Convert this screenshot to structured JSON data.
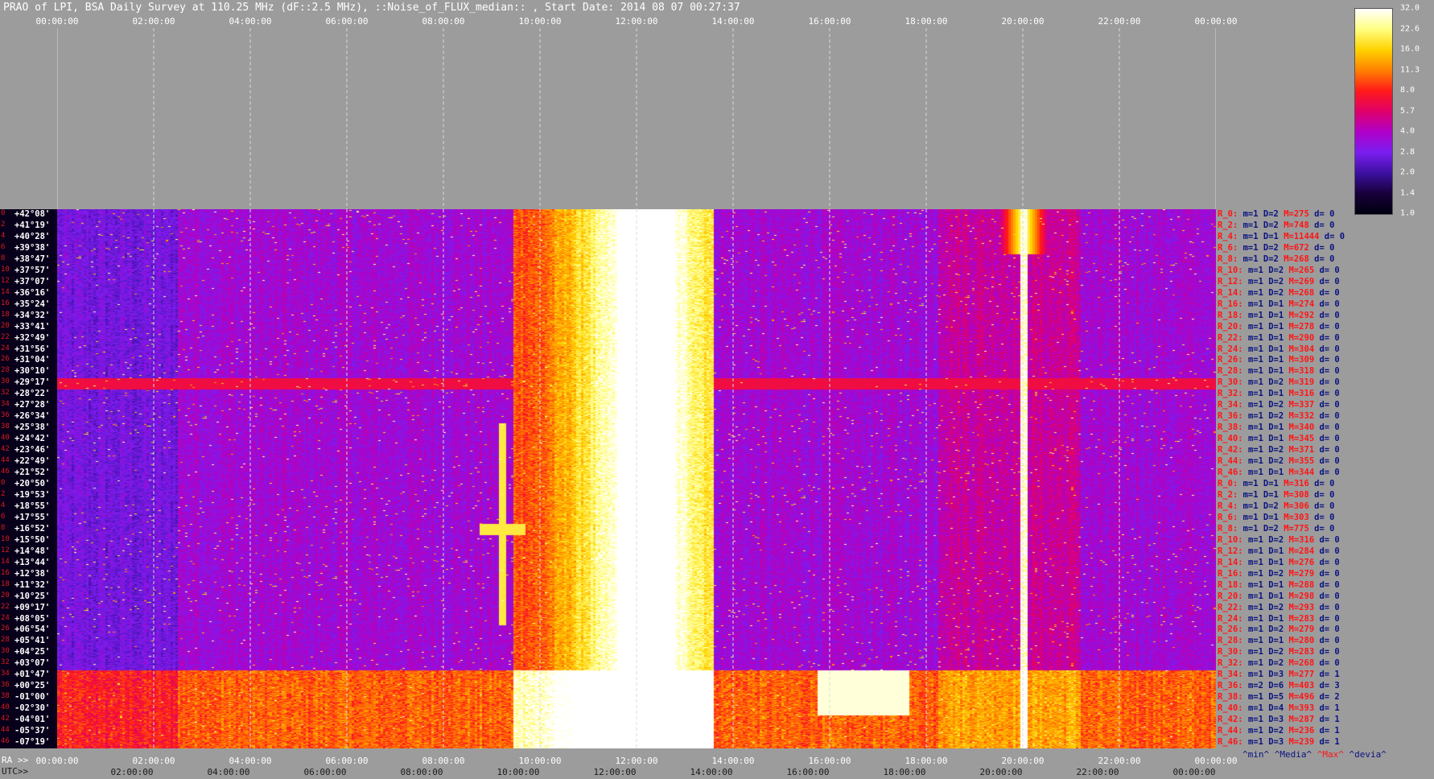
{
  "title": "PRAO of LPI, BSA Daily Survey at 110.25 MHz (dF::2.5 MHz), ::Noise_of_FLUX_median:: , Start Date: 2014 08 07 00:27:37",
  "top_axis": [
    "00:00:00",
    "02:00:00",
    "04:00:00",
    "06:00:00",
    "08:00:00",
    "10:00:00",
    "12:00:00",
    "14:00:00",
    "16:00:00",
    "18:00:00",
    "20:00:00",
    "22:00:00",
    "00:00:00"
  ],
  "bottom_axis": {
    "ra_label": "RA >>",
    "ra_ticks": [
      "00:00:00",
      "02:00:00",
      "04:00:00",
      "06:00:00",
      "08:00:00",
      "10:00:00",
      "12:00:00",
      "14:00:00",
      "16:00:00",
      "18:00:00",
      "20:00:00",
      "22:00:00",
      "00:00:00"
    ],
    "utc_label": "UTC>>",
    "utc_ticks": [
      "02:00:00",
      "04:00:00",
      "06:00:00",
      "08:00:00",
      "10:00:00",
      "12:00:00",
      "14:00:00",
      "16:00:00",
      "18:00:00",
      "20:00:00",
      "22:00:00",
      "00:00:00"
    ]
  },
  "declinations": [
    "+42°08'",
    "+41°19'",
    "+40°28'",
    "+39°38'",
    "+38°47'",
    "+37°57'",
    "+37°07'",
    "+36°16'",
    "+35°24'",
    "+34°32'",
    "+33°41'",
    "+32°49'",
    "+31°56'",
    "+31°04'",
    "+30°10'",
    "+29°17'",
    "+28°22'",
    "+27°28'",
    "+26°34'",
    "+25°38'",
    "+24°42'",
    "+23°46'",
    "+22°49'",
    "+21°52'",
    "+20°50'",
    "+19°53'",
    "+18°55'",
    "+17°55'",
    "+16°52'",
    "+15°50'",
    "+14°48'",
    "+13°44'",
    "+12°38'",
    "+11°32'",
    "+10°25'",
    "+09°17'",
    "+08°05'",
    "+06°54'",
    "+05°41'",
    "+04°25'",
    "+03°07'",
    "+01°47'",
    "+00°25'",
    "-01°00'",
    "-02°30'",
    "-04°01'",
    "-05°37'",
    "-07°19'"
  ],
  "row_indices": [
    "0",
    "2",
    "4",
    "6",
    "8",
    "10",
    "12",
    "14",
    "16",
    "18",
    "20",
    "22",
    "24",
    "26",
    "28",
    "30",
    "32",
    "34",
    "36",
    "38",
    "40",
    "42",
    "44",
    "46",
    "0",
    "2",
    "4",
    "6",
    "8",
    "10",
    "12",
    "14",
    "16",
    "18",
    "20",
    "22",
    "24",
    "26",
    "28",
    "30",
    "32",
    "34",
    "36",
    "38",
    "40",
    "42",
    "44",
    "46"
  ],
  "stats": [
    {
      "r": "R_0:",
      "m": "m=1",
      "D": "D=2",
      "M": "M=275",
      "d": "d= 0"
    },
    {
      "r": "R_2:",
      "m": "m=1",
      "D": "D=2",
      "M": "M=748",
      "d": "d= 0"
    },
    {
      "r": "R_4:",
      "m": "m=1",
      "D": "D=1",
      "M": "M=11444",
      "d": "d= 0"
    },
    {
      "r": "R_6:",
      "m": "m=1",
      "D": "D=2",
      "M": "M=672",
      "d": "d= 0"
    },
    {
      "r": "R_8:",
      "m": "m=1",
      "D": "D=2",
      "M": "M=268",
      "d": "d= 0"
    },
    {
      "r": "R_10:",
      "m": "m=1",
      "D": "D=2",
      "M": "M=265",
      "d": "d= 0"
    },
    {
      "r": "R_12:",
      "m": "m=1",
      "D": "D=2",
      "M": "M=269",
      "d": "d= 0"
    },
    {
      "r": "R_14:",
      "m": "m=1",
      "D": "D=2",
      "M": "M=268",
      "d": "d= 0"
    },
    {
      "r": "R_16:",
      "m": "m=1",
      "D": "D=1",
      "M": "M=274",
      "d": "d= 0"
    },
    {
      "r": "R_18:",
      "m": "m=1",
      "D": "D=1",
      "M": "M=292",
      "d": "d= 0"
    },
    {
      "r": "R_20:",
      "m": "m=1",
      "D": "D=1",
      "M": "M=278",
      "d": "d= 0"
    },
    {
      "r": "R_22:",
      "m": "m=1",
      "D": "D=1",
      "M": "M=290",
      "d": "d= 0"
    },
    {
      "r": "R_24:",
      "m": "m=1",
      "D": "D=1",
      "M": "M=304",
      "d": "d= 0"
    },
    {
      "r": "R_26:",
      "m": "m=1",
      "D": "D=1",
      "M": "M=309",
      "d": "d= 0"
    },
    {
      "r": "R_28:",
      "m": "m=1",
      "D": "D=1",
      "M": "M=318",
      "d": "d= 0"
    },
    {
      "r": "R_30:",
      "m": "m=1",
      "D": "D=2",
      "M": "M=319",
      "d": "d= 0"
    },
    {
      "r": "R_32:",
      "m": "m=1",
      "D": "D=1",
      "M": "M=316",
      "d": "d= 0"
    },
    {
      "r": "R_34:",
      "m": "m=1",
      "D": "D=2",
      "M": "M=337",
      "d": "d= 0"
    },
    {
      "r": "R_36:",
      "m": "m=1",
      "D": "D=2",
      "M": "M=332",
      "d": "d= 0"
    },
    {
      "r": "R_38:",
      "m": "m=1",
      "D": "D=1",
      "M": "M=340",
      "d": "d= 0"
    },
    {
      "r": "R_40:",
      "m": "m=1",
      "D": "D=1",
      "M": "M=345",
      "d": "d= 0"
    },
    {
      "r": "R_42:",
      "m": "m=1",
      "D": "D=2",
      "M": "M=371",
      "d": "d= 0"
    },
    {
      "r": "R_44:",
      "m": "m=1",
      "D": "D=2",
      "M": "M=355",
      "d": "d= 0"
    },
    {
      "r": "R_46:",
      "m": "m=1",
      "D": "D=1",
      "M": "M=344",
      "d": "d= 0"
    },
    {
      "r": "R_0:",
      "m": "m=1",
      "D": "D=1",
      "M": "M=316",
      "d": "d= 0"
    },
    {
      "r": "R_2:",
      "m": "m=1",
      "D": "D=1",
      "M": "M=308",
      "d": "d= 0"
    },
    {
      "r": "R_4:",
      "m": "m=1",
      "D": "D=2",
      "M": "M=306",
      "d": "d= 0"
    },
    {
      "r": "R_6:",
      "m": "m=1",
      "D": "D=1",
      "M": "M=303",
      "d": "d= 0"
    },
    {
      "r": "R_8:",
      "m": "m=1",
      "D": "D=2",
      "M": "M=775",
      "d": "d= 0"
    },
    {
      "r": "R_10:",
      "m": "m=1",
      "D": "D=2",
      "M": "M=316",
      "d": "d= 0"
    },
    {
      "r": "R_12:",
      "m": "m=1",
      "D": "D=1",
      "M": "M=284",
      "d": "d= 0"
    },
    {
      "r": "R_14:",
      "m": "m=1",
      "D": "D=1",
      "M": "M=276",
      "d": "d= 0"
    },
    {
      "r": "R_16:",
      "m": "m=1",
      "D": "D=2",
      "M": "M=279",
      "d": "d= 0"
    },
    {
      "r": "R_18:",
      "m": "m=1",
      "D": "D=1",
      "M": "M=288",
      "d": "d= 0"
    },
    {
      "r": "R_20:",
      "m": "m=1",
      "D": "D=1",
      "M": "M=298",
      "d": "d= 0"
    },
    {
      "r": "R_22:",
      "m": "m=1",
      "D": "D=2",
      "M": "M=293",
      "d": "d= 0"
    },
    {
      "r": "R_24:",
      "m": "m=1",
      "D": "D=1",
      "M": "M=283",
      "d": "d= 0"
    },
    {
      "r": "R_26:",
      "m": "m=1",
      "D": "D=2",
      "M": "M=279",
      "d": "d= 0"
    },
    {
      "r": "R_28:",
      "m": "m=1",
      "D": "D=1",
      "M": "M=280",
      "d": "d= 0"
    },
    {
      "r": "R_30:",
      "m": "m=1",
      "D": "D=2",
      "M": "M=283",
      "d": "d= 0"
    },
    {
      "r": "R_32:",
      "m": "m=1",
      "D": "D=2",
      "M": "M=268",
      "d": "d= 0"
    },
    {
      "r": "R_34:",
      "m": "m=1",
      "D": "D=3",
      "M": "M=277",
      "d": "d= 1"
    },
    {
      "r": "R_36:",
      "m": "m=2",
      "D": "D=6",
      "M": "M=403",
      "d": "d= 3"
    },
    {
      "r": "R_38:",
      "m": "m=1",
      "D": "D=5",
      "M": "M=496",
      "d": "d= 2"
    },
    {
      "r": "R_40:",
      "m": "m=1",
      "D": "D=4",
      "M": "M=393",
      "d": "d= 1"
    },
    {
      "r": "R_42:",
      "m": "m=1",
      "D": "D=3",
      "M": "M=287",
      "d": "d= 1"
    },
    {
      "r": "R_44:",
      "m": "m=1",
      "D": "D=2",
      "M": "M=236",
      "d": "d= 1"
    },
    {
      "r": "R_46:",
      "m": "m=1",
      "D": "D=3",
      "M": "M=239",
      "d": "d= 1"
    }
  ],
  "stat_legend": {
    "min": "^min^",
    "media": "^Media^",
    "max": "^Max^",
    "devia": "^devia^"
  },
  "colorbar": {
    "ticks": [
      "32.0",
      "22.6",
      "16.0",
      "11.3",
      "8.0",
      "5.7",
      "4.0",
      "2.8",
      "2.0",
      "1.4",
      "1.0"
    ],
    "stops": [
      "#ffffff",
      "#ffff80",
      "#ffd200",
      "#ff8000",
      "#ff1a1a",
      "#e0006a",
      "#b000c8",
      "#7a1ef0",
      "#3c10a0",
      "#18003a",
      "#000010"
    ]
  },
  "colors": {
    "background": "#9c9c9c",
    "grid": "#d8d8d8",
    "index_red": "#d81b1b",
    "stat_blue": "#0b1380",
    "stat_red": "#ff1515"
  },
  "chart_data": {
    "type": "heatmap",
    "title": "PRAO of LPI, BSA Daily Survey at 110.25 MHz (dF::2.5 MHz), ::Noise_of_FLUX_median:: , Start Date: 2014 08 07 00:27:37",
    "x_axis": "RA / UTC, 00:00:00 to 24:00:00",
    "y_axis": "Declination, +42°08' to -07°19' (48 beams)",
    "color_scale": {
      "min": 1.0,
      "max": 32.0,
      "scale": "log2"
    },
    "features": [
      {
        "name": "broad bright band",
        "ra_start_h": 9.4,
        "ra_end_h": 13.5,
        "level": "max"
      },
      {
        "name": "narrow saturated band",
        "ra_start_h": 11.6,
        "ra_end_h": 12.8,
        "level": 32.0
      },
      {
        "name": "point source",
        "ra_h": 20.0,
        "dec_row": 2,
        "level": 32.0
      },
      {
        "name": "vertical stripe",
        "ra_h": 20.0,
        "level": 16.0
      },
      {
        "name": "point source",
        "ra_h": 9.2,
        "dec_row": 28,
        "level": 22.6
      },
      {
        "name": "horizontal interference line",
        "dec_row": 15,
        "level": 2.8
      },
      {
        "name": "low-declination bright band",
        "dec_rows": [
          41,
          47
        ],
        "level": 8.0
      },
      {
        "name": "bright patch",
        "ra_start_h": 15.7,
        "ra_end_h": 17.6,
        "dec_rows": [
          41,
          44
        ],
        "level": 32.0
      }
    ]
  }
}
